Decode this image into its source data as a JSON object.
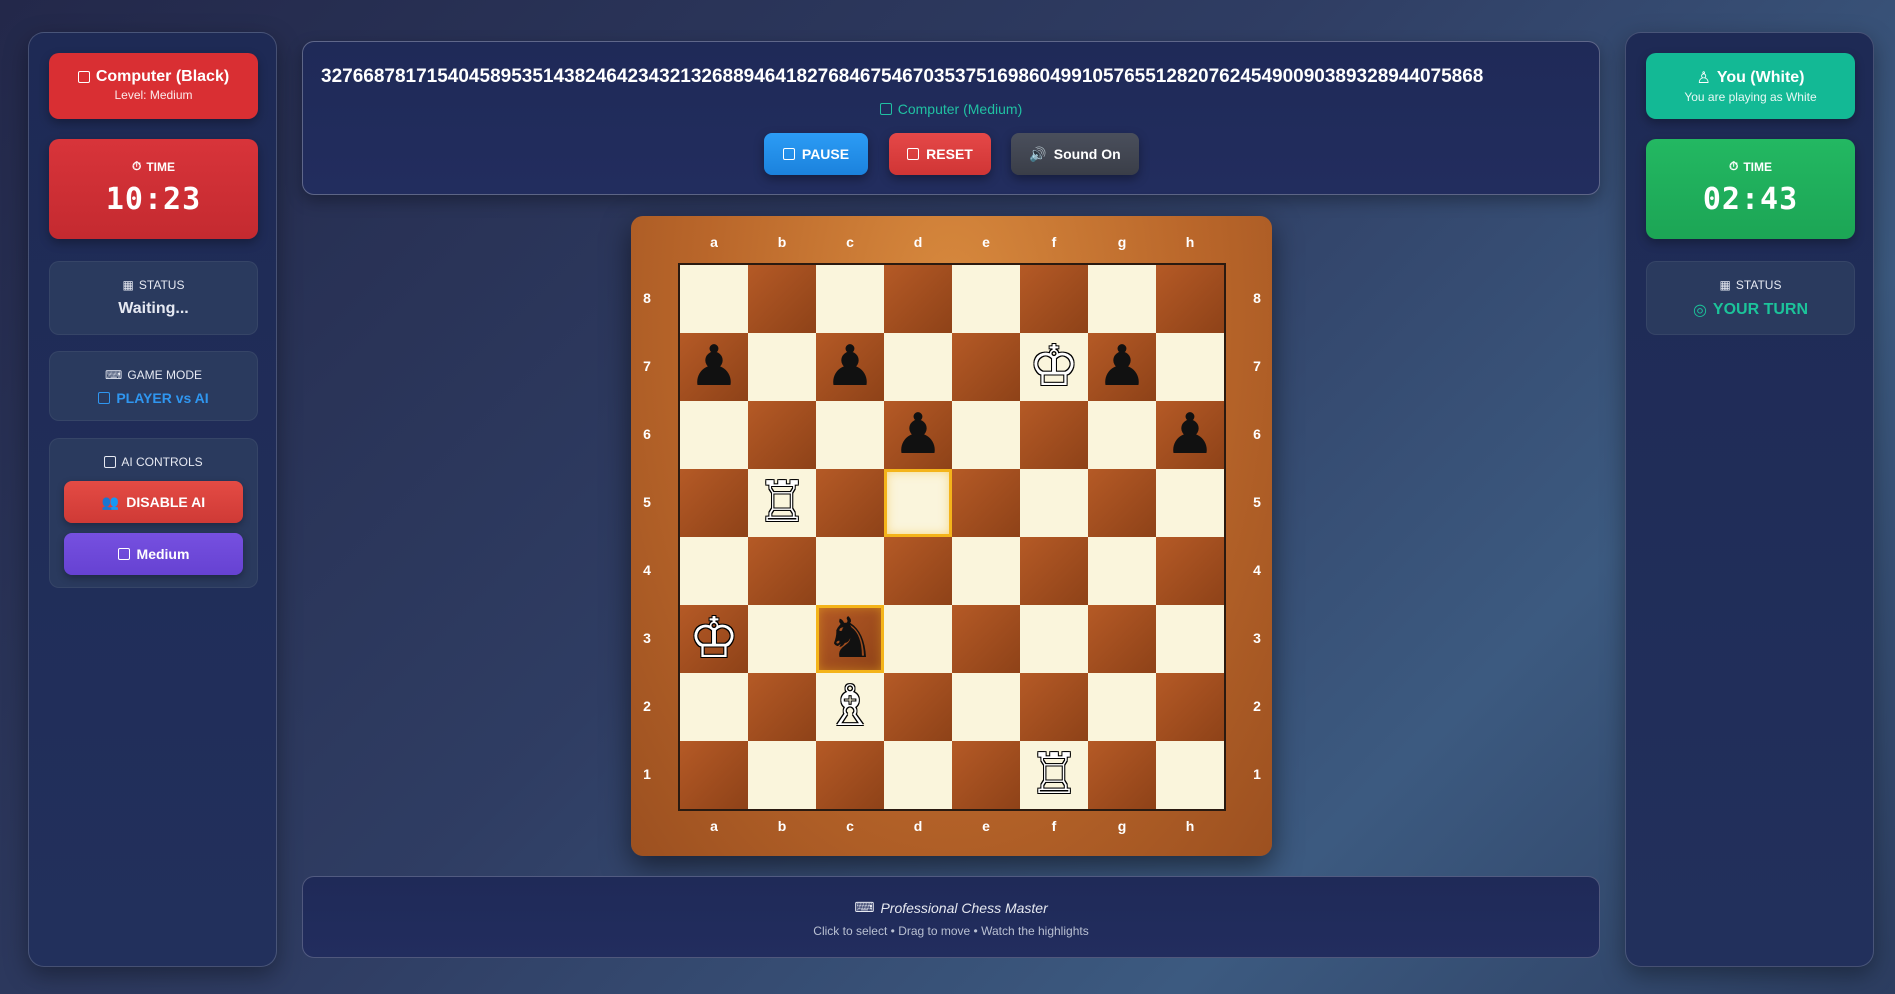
{
  "left_panel": {
    "player_name": "Computer (Black)",
    "player_sub": "Level: Medium",
    "time_label": "TIME",
    "time_value": "10:23",
    "status_label": "STATUS",
    "status_value": "Waiting...",
    "mode_label": "GAME MODE",
    "mode_value": "PLAYER vs AI",
    "ai_label": "AI CONTROLS",
    "disable_ai_label": "DISABLE AI",
    "level_label": "Medium"
  },
  "right_panel": {
    "player_name": "You (White)",
    "player_sub": "You are playing as White",
    "time_label": "TIME",
    "time_value": "02:43",
    "status_label": "STATUS",
    "status_value": "YOUR TURN"
  },
  "header": {
    "move_string": "32766878171540458953514382464234321326889464182768467546703537516986049910576551282076245490090389328944075868",
    "opponent_label": "Computer (Medium)",
    "pause_label": "PAUSE",
    "reset_label": "RESET",
    "sound_label": "Sound On"
  },
  "board": {
    "files": [
      "a",
      "b",
      "c",
      "d",
      "e",
      "f",
      "g",
      "h"
    ],
    "ranks": [
      "8",
      "7",
      "6",
      "5",
      "4",
      "3",
      "2",
      "1"
    ],
    "pieces": {
      "a7": "black-pawn",
      "c7": "black-pawn",
      "f7": "white-king",
      "g7": "black-pawn",
      "d6": "black-pawn",
      "h6": "black-pawn",
      "b5": "white-rook",
      "a3": "white-king",
      "c3": "black-knight",
      "c2": "white-bishop",
      "f1": "white-rook"
    },
    "highlights": [
      "d5",
      "c3"
    ],
    "colors": {
      "light": "#faf5dc",
      "dark": "#a34e20",
      "highlight": "#f4b41a"
    }
  },
  "footer": {
    "title": "Professional Chess Master",
    "hint": "Click to select • Drag to move • Watch the highlights"
  }
}
